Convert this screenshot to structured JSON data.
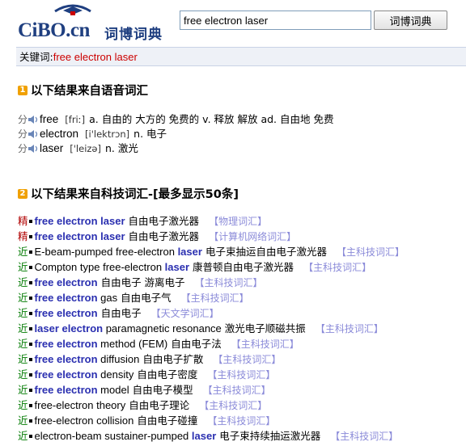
{
  "header": {
    "logo_text": "CiBO.cn",
    "logo_cn": "词博词典",
    "search_value": "free electron laser",
    "search_button": "词博词典"
  },
  "keyword": {
    "label": "关键词:",
    "value": "free electron laser"
  },
  "section1": {
    "badge": "1",
    "title": "以下结果来自语音词汇",
    "rows": [
      {
        "prefix": "分",
        "word": "free",
        "phonetic": "[friː]",
        "definition": "a. 自由的 大方的 免费的 v. 释放 解放 ad. 自由地 免费"
      },
      {
        "prefix": "分",
        "word": "electron",
        "phonetic": "[i'lektrɔn]",
        "definition": "n. 电子"
      },
      {
        "prefix": "分",
        "word": "laser",
        "phonetic": "['leizə]",
        "definition": "n. 激光"
      }
    ]
  },
  "section2": {
    "badge": "2",
    "title": "以下结果来自科技词汇-[最多显示50条]",
    "entries": [
      {
        "tag": "精",
        "term": "free electron laser",
        "cn": "自由电子激光器",
        "source": "【物理词汇】"
      },
      {
        "tag": "精",
        "term": "free electron laser",
        "cn": "自由电子激光器",
        "source": "【计算机网络词汇】"
      },
      {
        "tag": "近",
        "term": "E-beam-pumped free-electron laser",
        "cn": "电子束抽运自由电子激光器",
        "source": "【主科技词汇】"
      },
      {
        "tag": "近",
        "term": "Compton type free-electron laser",
        "cn": "康普顿自由电子激光器",
        "source": "【主科技词汇】"
      },
      {
        "tag": "近",
        "term": "free electron",
        "cn": "自由电子 游离电子",
        "source": "【主科技词汇】"
      },
      {
        "tag": "近",
        "term": "free electron gas",
        "cn": "自由电子气",
        "source": "【主科技词汇】"
      },
      {
        "tag": "近",
        "term": "free electron",
        "cn": "自由电子",
        "source": "【天文学词汇】"
      },
      {
        "tag": "近",
        "term": "laser electron paramagnetic resonance",
        "cn": "激光电子顺磁共振",
        "source": "【主科技词汇】"
      },
      {
        "tag": "近",
        "term": "free electron method (FEM)",
        "cn": "自由电子法",
        "source": "【主科技词汇】"
      },
      {
        "tag": "近",
        "term": "free electron diffusion",
        "cn": "自由电子扩散",
        "source": "【主科技词汇】"
      },
      {
        "tag": "近",
        "term": "free electron density",
        "cn": "自由电子密度",
        "source": "【主科技词汇】"
      },
      {
        "tag": "近",
        "term": "free electron model",
        "cn": "自由电子模型",
        "source": "【主科技词汇】"
      },
      {
        "tag": "近",
        "term": "free-electron theory",
        "cn": "自由电子理论",
        "source": "【主科技词汇】"
      },
      {
        "tag": "近",
        "term": "free-electron collision",
        "cn": "自由电子碰撞",
        "source": "【主科技词汇】"
      },
      {
        "tag": "近",
        "term": "electron-beam sustainer-pumped laser",
        "cn": "电子束持续抽运激光器",
        "source": "【主科技词汇】"
      }
    ]
  },
  "colors": {
    "logo": "#1f3f80",
    "keyword": "#cc0000",
    "term_highlight": "#2a2fb0",
    "source": "#8b8bd9",
    "tag_jing": "#b00000",
    "tag_jin": "#007a00",
    "badge": "#f0a000"
  }
}
